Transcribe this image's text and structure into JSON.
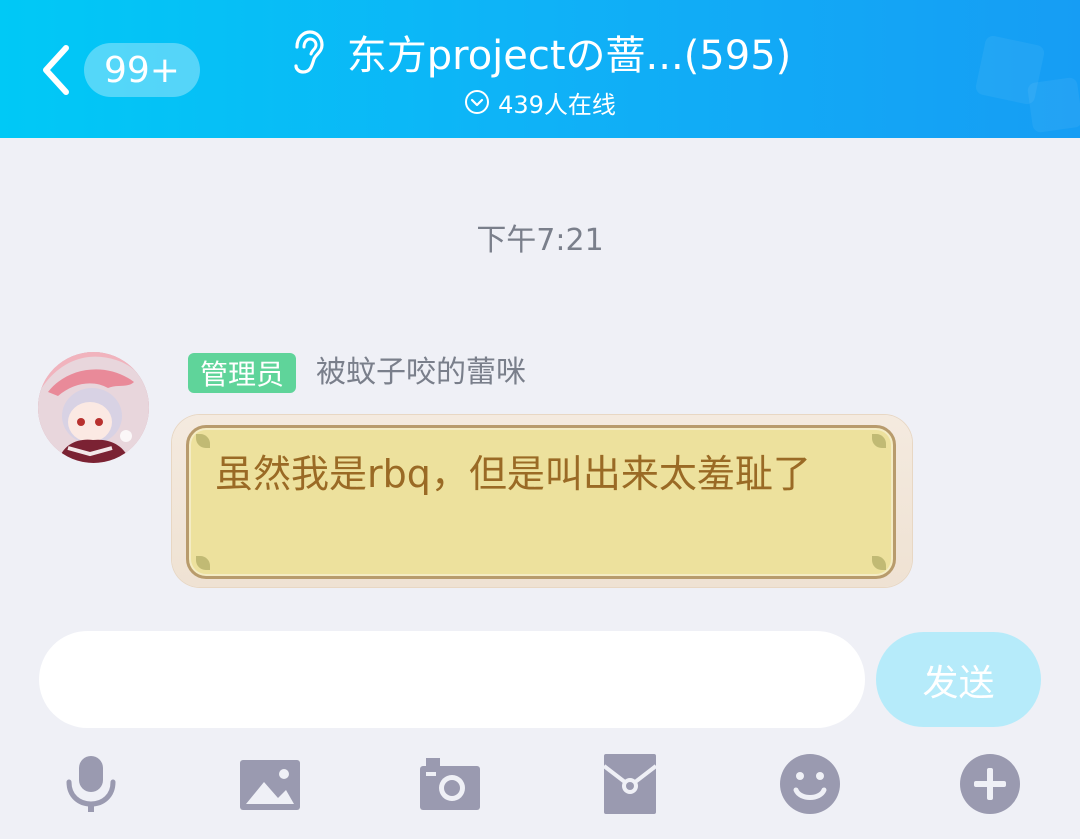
{
  "header": {
    "back_badge": "99+",
    "title": "东方projectの蔷...(595)",
    "online": "439人在线"
  },
  "chat": {
    "timestamp": "下午7:21",
    "message": {
      "role": "管理员",
      "sender": "被蚊子咬的蕾咪",
      "text": "虽然我是rbq，但是叫出来太羞耻了"
    }
  },
  "composer": {
    "input_value": "",
    "send_label": "发送"
  },
  "toolbar": {
    "items": [
      "microphone-icon",
      "image-icon",
      "camera-icon",
      "red-packet-icon",
      "emoji-icon",
      "plus-icon"
    ]
  },
  "colors": {
    "header_start": "#00c9f6",
    "header_end": "#169df4",
    "role_badge": "#5fd49a",
    "bubble_fill": "#ede19d",
    "bubble_text": "#9a6a25",
    "send_button": "#b6ebfa",
    "icon_gray": "#9a9ab0"
  }
}
